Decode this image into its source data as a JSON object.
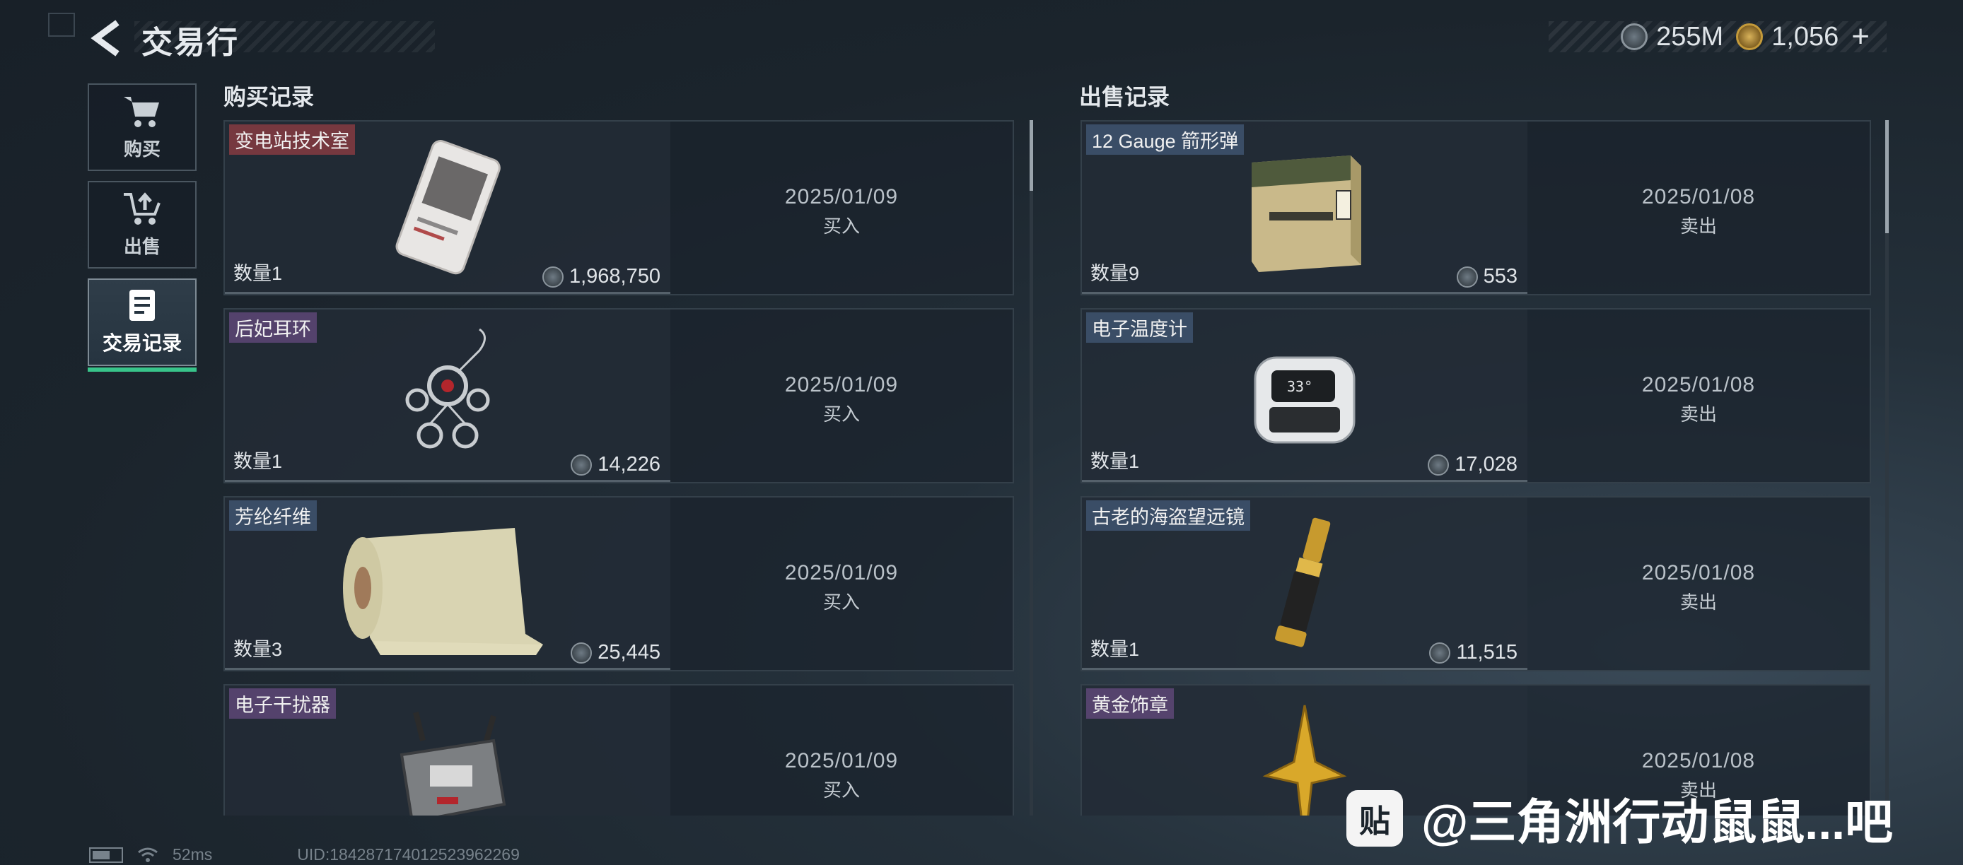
{
  "header": {
    "title": "交易行",
    "currency": [
      {
        "icon": "silver-coin-icon",
        "value": "255M"
      },
      {
        "icon": "gold-coin-icon",
        "value": "1,056"
      }
    ],
    "plus_label": "+"
  },
  "nav": {
    "items": [
      {
        "label": "购买",
        "icon": "cart-icon",
        "active": false
      },
      {
        "label": "出售",
        "icon": "sell-upload-icon",
        "active": false
      },
      {
        "label": "交易记录",
        "icon": "record-document-icon",
        "active": true
      }
    ]
  },
  "buy": {
    "heading": "购买记录",
    "items": [
      {
        "name": "变电站技术室",
        "tag": "red",
        "icon": "keycard-icon",
        "qty": "数量1",
        "price": "1,968,750",
        "date": "2025/01/09",
        "type": "买入"
      },
      {
        "name": "后妃耳环",
        "tag": "purple",
        "icon": "earring-icon",
        "qty": "数量1",
        "price": "14,226",
        "date": "2025/01/09",
        "type": "买入"
      },
      {
        "name": "芳纶纤维",
        "tag": "blue",
        "icon": "fabric-roll-icon",
        "qty": "数量3",
        "price": "25,445",
        "date": "2025/01/09",
        "type": "买入"
      },
      {
        "name": "电子干扰器",
        "tag": "purple",
        "icon": "jammer-device-icon",
        "qty": "",
        "price": "",
        "date": "2025/01/09",
        "type": "买入"
      }
    ]
  },
  "sell": {
    "heading": "出售记录",
    "items": [
      {
        "name": "12 Gauge 箭形弹",
        "tag": "blue",
        "icon": "ammo-box-icon",
        "qty": "数量9",
        "price": "553",
        "date": "2025/01/08",
        "type": "卖出"
      },
      {
        "name": "电子温度计",
        "tag": "blue",
        "icon": "thermometer-device-icon",
        "qty": "数量1",
        "price": "17,028",
        "date": "2025/01/08",
        "type": "卖出"
      },
      {
        "name": "古老的海盗望远镜",
        "tag": "blue",
        "icon": "telescope-icon",
        "qty": "数量1",
        "price": "11,515",
        "date": "2025/01/08",
        "type": "卖出"
      },
      {
        "name": "黄金饰章",
        "tag": "purple",
        "icon": "gold-emblem-icon",
        "qty": "",
        "price": "",
        "date": "2025/01/08",
        "type": "卖出"
      }
    ]
  },
  "footer": {
    "ping": "52ms",
    "uid": "UID:184287174012523962269"
  },
  "watermark": {
    "logo": "贴",
    "text": "@三角洲行动鼠鼠...吧"
  }
}
